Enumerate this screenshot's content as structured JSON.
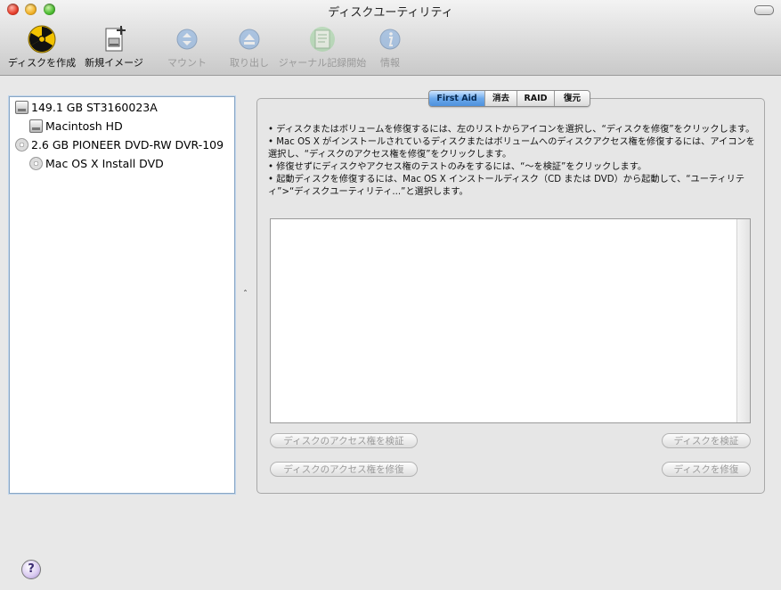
{
  "window": {
    "title": "ディスクユーティリティ"
  },
  "toolbar": {
    "items": [
      {
        "label": "ディスクを作成",
        "icon": "burn-icon",
        "enabled": true
      },
      {
        "label": "新規イメージ",
        "icon": "new-image-icon",
        "enabled": true
      },
      {
        "label": "マウント",
        "icon": "mount-icon",
        "enabled": false
      },
      {
        "label": "取り出し",
        "icon": "eject-icon",
        "enabled": false
      },
      {
        "label": "ジャーナル記録開始",
        "icon": "journaling-icon",
        "enabled": false
      },
      {
        "label": "情報",
        "icon": "info-icon",
        "enabled": false
      }
    ]
  },
  "sidebar": {
    "items": [
      {
        "label": "149.1 GB ST3160023A",
        "icon": "hard-disk-icon",
        "level": 0
      },
      {
        "label": "Macintosh HD",
        "icon": "volume-icon",
        "level": 1
      },
      {
        "label": "2.6 GB PIONEER DVD-RW  DVR-109",
        "icon": "dvd-drive-icon",
        "level": 0
      },
      {
        "label": "Mac OS X Install DVD",
        "icon": "dvd-icon",
        "level": 1
      }
    ]
  },
  "tabs": [
    {
      "label": "First Aid",
      "active": true
    },
    {
      "label": "消去",
      "active": false
    },
    {
      "label": "RAID",
      "active": false
    },
    {
      "label": "復元",
      "active": false
    }
  ],
  "first_aid": {
    "instructions": [
      "• ディスクまたはボリュームを修復するには、左のリストからアイコンを選択し、“ディスクを修復”をクリックします。",
      "• Mac OS X がインストールされているディスクまたはボリュームへのディスクアクセス権を修復するには、アイコンを選択し、“ディスクのアクセス権を修復”をクリックします。",
      "• 修復せずにディスクやアクセス権のテストのみをするには、“〜を検証”をクリックします。",
      "• 起動ディスクを修復するには、Mac OS X インストールディスク（CD または DVD）から起動して、“ユーティリティ”>“ディスクユーティリティ...”と選択します。"
    ],
    "buttons": {
      "verify_permissions": "ディスクのアクセス権を検証",
      "verify_disk": "ディスクを検証",
      "repair_permissions": "ディスクのアクセス権を修復",
      "repair_disk": "ディスクを修復"
    }
  },
  "help_label": "?"
}
